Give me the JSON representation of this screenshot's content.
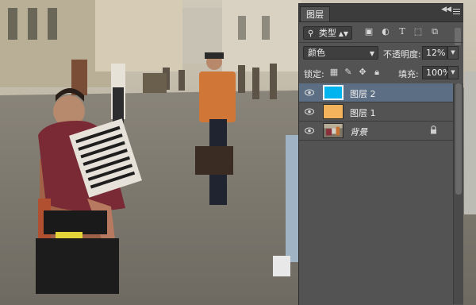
{
  "panel": {
    "tab_label": "图层",
    "filter": {
      "label": "类型",
      "icon": "search-icon"
    },
    "filter_icons": [
      "image-filter-icon",
      "adjustment-filter-icon",
      "type-filter-icon",
      "shape-filter-icon",
      "smart-object-filter-icon"
    ],
    "blend_mode": "颜色",
    "opacity_label": "不透明度:",
    "opacity_value": "12%",
    "lock_label": "锁定:",
    "lock_icons": [
      "lock-transparent-icon",
      "lock-paint-icon",
      "lock-position-icon",
      "lock-all-icon"
    ],
    "fill_label": "填充:",
    "fill_value": "100%"
  },
  "layers": [
    {
      "name": "图层 2",
      "swatch": "#00b4ef",
      "selected": true,
      "locked": false
    },
    {
      "name": "图层 1",
      "swatch": "#f3b35c",
      "selected": false,
      "locked": false
    },
    {
      "name": "背景",
      "swatch": "photo",
      "selected": false,
      "locked": true
    }
  ],
  "colors": {
    "panel_bg": "#535353",
    "selected_row": "#5c6e83",
    "layer2_fill": "#00b4ef",
    "layer1_fill": "#f3b35c"
  }
}
